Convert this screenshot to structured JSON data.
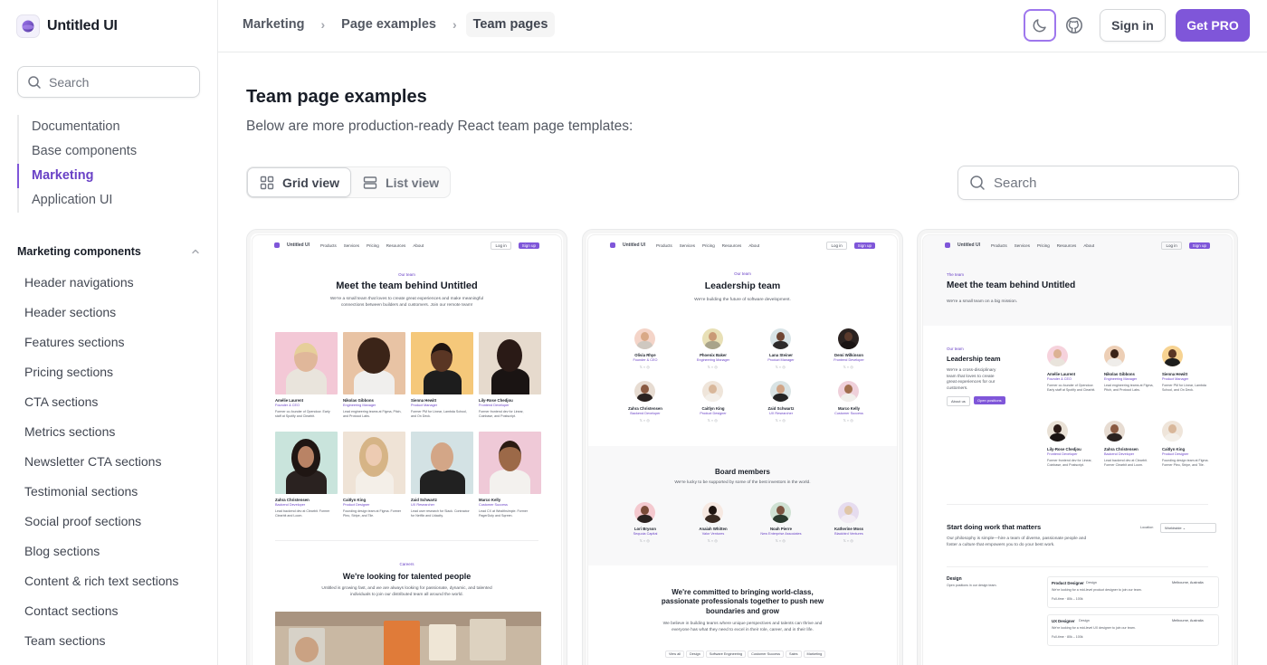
{
  "brand": {
    "name": "Untitled UI"
  },
  "sidebar": {
    "search_placeholder": "Search",
    "top_items": [
      {
        "label": "Documentation",
        "active": false
      },
      {
        "label": "Base components",
        "active": false
      },
      {
        "label": "Marketing",
        "active": true
      },
      {
        "label": "Application UI",
        "active": false
      }
    ],
    "section_title": "Marketing components",
    "section_items": [
      "Header navigations",
      "Header sections",
      "Features sections",
      "Pricing sections",
      "CTA sections",
      "Metrics sections",
      "Newsletter CTA sections",
      "Testimonial sections",
      "Social proof sections",
      "Blog sections",
      "Content & rich text sections",
      "Contact sections",
      "Team sections"
    ]
  },
  "breadcrumb": [
    "Marketing",
    "Page examples",
    "Team pages"
  ],
  "header": {
    "signin_label": "Sign in",
    "getpro_label": "Get PRO"
  },
  "main": {
    "title": "Team page examples",
    "subtitle": "Below are more production-ready React team page templates:",
    "views": [
      {
        "label": "Grid view",
        "active": true,
        "icon": "grid-icon"
      },
      {
        "label": "List view",
        "active": false,
        "icon": "list-icon"
      }
    ],
    "search_placeholder": "Search"
  },
  "colors": {
    "brand": "#7f56d9",
    "brand_text": "#6941c6",
    "border": "#e9eaeb",
    "muted": "#535862"
  },
  "previews": {
    "nav": {
      "brand": "Untitled UI",
      "links": [
        "Products",
        "Services",
        "Pricing",
        "Resources",
        "About"
      ],
      "login": "Log in",
      "signup": "Sign up"
    },
    "one": {
      "eyebrow": "Our team",
      "heading": "Meet the team behind Untitled",
      "text": "We're a small team that loves to create great experiences and make meaningful connections between builders and customers. Join our remote team!",
      "members": [
        {
          "name": "Amélie Laurent",
          "role": "Founder & CEO",
          "desc": "Former co-founder of Opendoor. Early staff at Spotify and Clearbit."
        },
        {
          "name": "Nikolas Gibbons",
          "role": "Engineering Manager",
          "desc": "Lead engineering teams at Figma, Pitch, and Protocol Labs."
        },
        {
          "name": "Sienna Hewitt",
          "role": "Product Manager",
          "desc": "Former PM for Linear, Lambda School, and On Deck."
        },
        {
          "name": "Lily-Rose Chedjou",
          "role": "Frontend Developer",
          "desc": "Former frontend dev for Linear, Coinbase, and Postscript."
        },
        {
          "name": "Zahra Christensen",
          "role": "Backend Developer",
          "desc": "Lead backend dev at Clearbit. Former Clearbit and Loom."
        },
        {
          "name": "Caitlyn King",
          "role": "Product Designer",
          "desc": "Founding design team at Figma. Former Pleo, Stripe, and Tile."
        },
        {
          "name": "Zaid Schwartz",
          "role": "UX Researcher",
          "desc": "Lead user research for Slack. Contractor for Netflix and Udacity."
        },
        {
          "name": "Marco Kelly",
          "role": "Customer Success",
          "desc": "Lead CX at Wealthsimple. Former PagerDuty and Sqreen."
        }
      ],
      "careers_eyebrow": "Careers",
      "careers_heading": "We're looking for talented people",
      "careers_text": "Untitled is growing fast, and we are always looking for passionate, dynamic, and talented individuals to join our distributed team all around the world."
    },
    "two": {
      "eyebrow": "Our team",
      "heading": "Leadership team",
      "text": "We're building the future of software development.",
      "members": [
        {
          "name": "Olivia Rhye",
          "role": "Founder & CEO"
        },
        {
          "name": "Phoenix Baker",
          "role": "Engineering Manager"
        },
        {
          "name": "Lana Steiner",
          "role": "Product Manager"
        },
        {
          "name": "Demi Wilkinson",
          "role": "Frontend Developer"
        },
        {
          "name": "Zahra Christensen",
          "role": "Backend Developer"
        },
        {
          "name": "Caitlyn King",
          "role": "Product Designer"
        },
        {
          "name": "Zaid Schwartz",
          "role": "UX Researcher"
        },
        {
          "name": "Marco Kelly",
          "role": "Customer Success"
        }
      ],
      "board_heading": "Board members",
      "board_text": "We're lucky to be supported by some of the best investors in the world.",
      "board": [
        {
          "name": "Lori Bryson",
          "role": "Sequoia Capital"
        },
        {
          "name": "Anaiah Whitten",
          "role": "Valor Ventures"
        },
        {
          "name": "Noah Pierre",
          "role": "New Enterprise Associates"
        },
        {
          "name": "Katherine Moss",
          "role": "Blackbird Ventures"
        }
      ],
      "mission_heading": "We're committed to bringing world-class, passionate professionals together to push new boundaries and grow",
      "mission_text": "We believe in building teams where unique perspectives and talents can thrive and everyone has what they need to excel in their role, career, and in their life.",
      "tabs": [
        "View all",
        "Design",
        "Software Engineering",
        "Customer Success",
        "Sales",
        "Marketing"
      ]
    },
    "three": {
      "eyebrow": "The team",
      "heading": "Meet the team behind Untitled",
      "text": "We're a small team on a big mission.",
      "side_eyebrow": "Our team",
      "side_heading": "Leadership team",
      "side_text": "We're a cross-disciplinary team that loves to create great experiences for our customers.",
      "btn_about": "About us",
      "btn_positions": "Open positions",
      "members": [
        {
          "name": "Amélie Laurent",
          "role": "Founder & CEO",
          "desc": "Former co-founder of Opendoor. Early staff at Spotify and Clearbit."
        },
        {
          "name": "Nikolas Gibbons",
          "role": "Engineering Manager",
          "desc": "Lead engineering teams at Figma, Pitch, and Protocol Labs."
        },
        {
          "name": "Sienna Hewitt",
          "role": "Product Manager",
          "desc": "Former PM for Linear, Lambda School, and On Deck."
        },
        {
          "name": "Lily-Rose Chedjou",
          "role": "Frontend Developer",
          "desc": "Former frontend dev for Linear, Coinbase, and Postscript."
        },
        {
          "name": "Zahra Christensen",
          "role": "Backend Developer",
          "desc": "Lead backend dev at Clearbit. Former Clearbit and Loom."
        },
        {
          "name": "Caitlyn King",
          "role": "Product Designer",
          "desc": "Founding design team at Figma. Former Pleo, Stripe, and Tile."
        }
      ],
      "jobs_heading": "Start doing work that matters",
      "jobs_text": "Our philosophy is simple—hire a team of diverse, passionate people and foster a culture that empowers you to do your best work.",
      "location_label": "Location",
      "location_value": "Worldwide",
      "dept": "Design",
      "dept_text": "Open positions in our design team.",
      "jobs": [
        {
          "title": "Product Designer",
          "tag": "Design",
          "location": "Melbourne, Australia",
          "desc": "We're looking for a mid-level product designer to join our team.",
          "meta": "Full-time · 80k – 100k"
        },
        {
          "title": "UX Designer",
          "tag": "Design",
          "location": "Melbourne, Australia",
          "desc": "We're looking for a mid-level UX designer to join our team.",
          "meta": "Full-time · 80k – 100k"
        }
      ]
    }
  }
}
